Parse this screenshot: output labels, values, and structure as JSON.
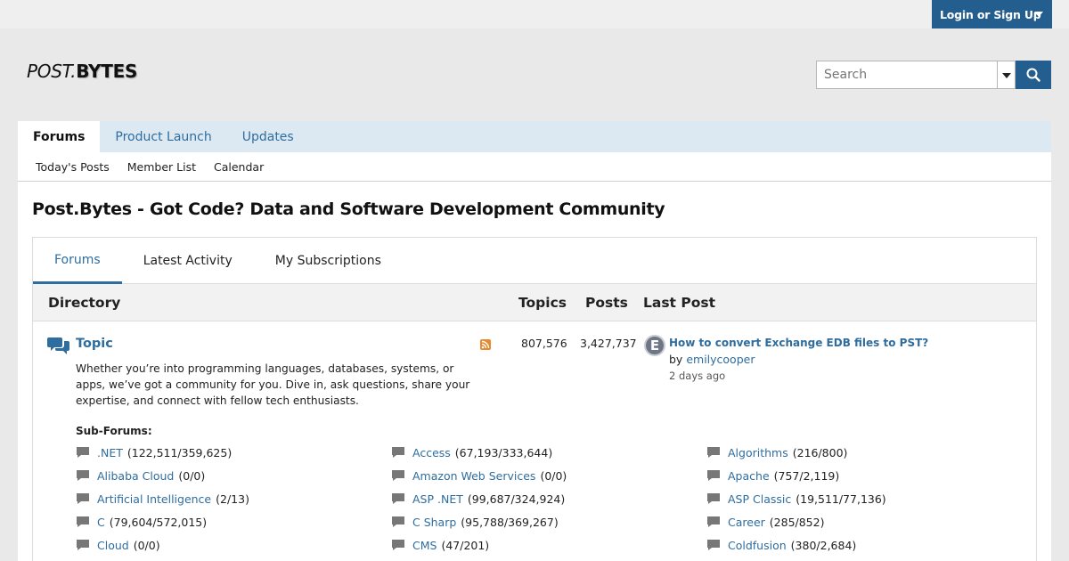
{
  "header": {
    "login_label": "Login or Sign Up",
    "logo_part1": "POST.",
    "logo_part2": "BYTES",
    "search_placeholder": "Search"
  },
  "nav": {
    "tabs": [
      {
        "label": "Forums",
        "active": true
      },
      {
        "label": "Product Launch",
        "active": false
      },
      {
        "label": "Updates",
        "active": false
      }
    ],
    "subnav": [
      "Today's Posts",
      "Member List",
      "Calendar"
    ]
  },
  "page": {
    "title": "Post.Bytes - Got Code? Data and Software Development Community",
    "tabs": [
      "Forums",
      "Latest Activity",
      "My Subscriptions"
    ]
  },
  "directory": {
    "headers": {
      "directory": "Directory",
      "topics": "Topics",
      "posts": "Posts",
      "last_post": "Last Post"
    },
    "forum": {
      "name": "Topic",
      "description": "Whether you’re into programming languages, databases, systems, or apps, we’ve got a community for you. Dive in, ask questions, share your expertise, and connect with fellow tech enthusiasts.",
      "topics": "807,576",
      "posts": "3,427,737",
      "last_post": {
        "avatar_letter": "E",
        "title": "How to convert Exchange EDB files to PST?",
        "by_label": "by",
        "user": "emilycooper",
        "time": "2 days ago"
      }
    },
    "subforums_label": "Sub-Forums:",
    "subforums": [
      {
        "name": ".NET",
        "count": "(122,511/359,625)"
      },
      {
        "name": "Access",
        "count": "(67,193/333,644)"
      },
      {
        "name": "Algorithms",
        "count": "(216/800)"
      },
      {
        "name": "Alibaba Cloud",
        "count": "(0/0)"
      },
      {
        "name": "Amazon Web Services",
        "count": "(0/0)"
      },
      {
        "name": "Apache",
        "count": "(757/2,119)"
      },
      {
        "name": "Artificial Intelligence",
        "count": "(2/13)"
      },
      {
        "name": "ASP .NET",
        "count": "(99,687/324,924)"
      },
      {
        "name": "ASP Classic",
        "count": "(19,511/77,136)"
      },
      {
        "name": "C",
        "count": "(79,604/572,015)"
      },
      {
        "name": "C Sharp",
        "count": "(95,788/369,267)"
      },
      {
        "name": "Career",
        "count": "(285/852)"
      },
      {
        "name": "Cloud",
        "count": "(0/0)"
      },
      {
        "name": "CMS",
        "count": "(47/201)"
      },
      {
        "name": "Coldfusion",
        "count": "(380/2,684)"
      }
    ]
  },
  "colors": {
    "accent": "#245e8f",
    "link": "#2f6d9e",
    "nav_bg": "#dde9f2"
  }
}
